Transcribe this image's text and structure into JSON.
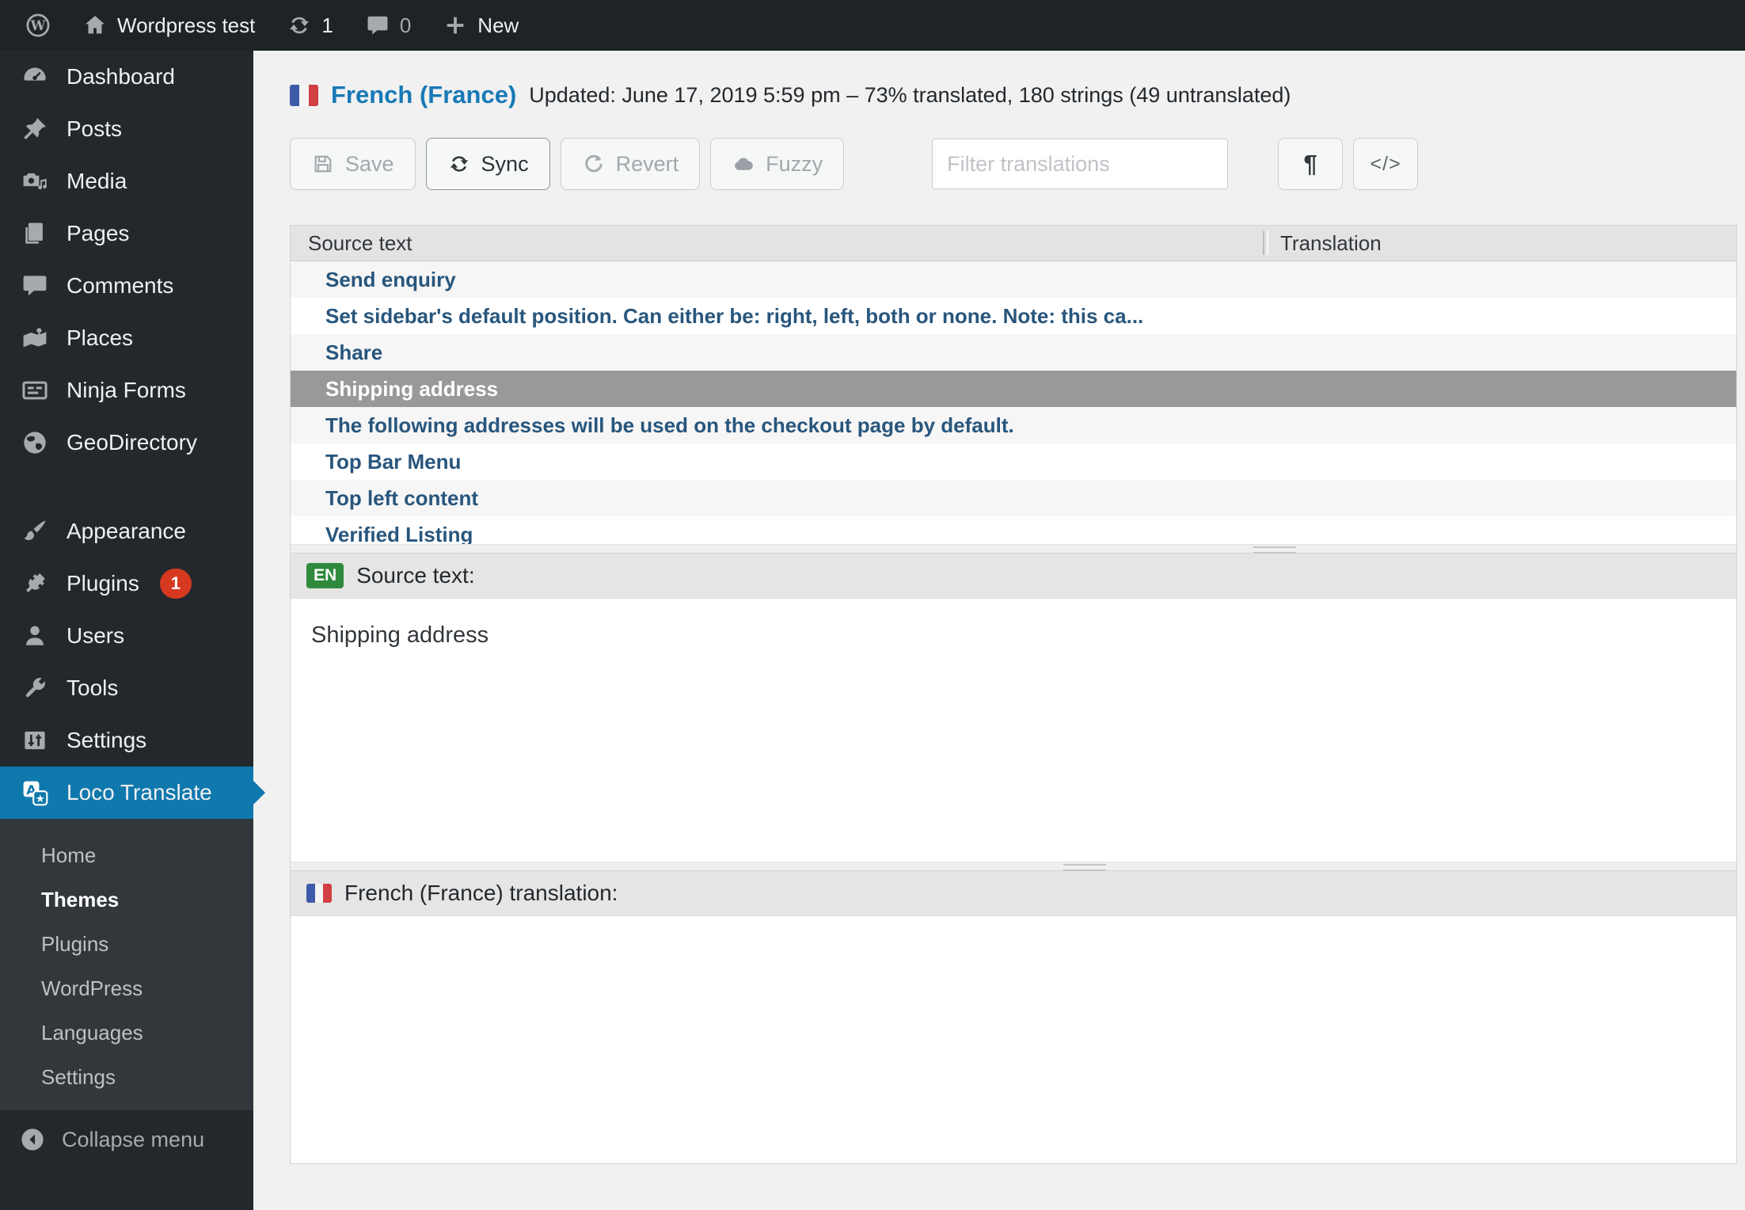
{
  "admin_bar": {
    "site_name": "Wordpress test",
    "update_count": "1",
    "comment_count": "0",
    "new_label": "New"
  },
  "sidebar": {
    "items": [
      {
        "label": "Dashboard"
      },
      {
        "label": "Posts"
      },
      {
        "label": "Media"
      },
      {
        "label": "Pages"
      },
      {
        "label": "Comments"
      },
      {
        "label": "Places"
      },
      {
        "label": "Ninja Forms"
      },
      {
        "label": "GeoDirectory"
      },
      {
        "label": "Appearance"
      },
      {
        "label": "Plugins",
        "badge": "1"
      },
      {
        "label": "Users"
      },
      {
        "label": "Tools"
      },
      {
        "label": "Settings"
      },
      {
        "label": "Loco Translate"
      }
    ],
    "submenu": [
      {
        "label": "Home"
      },
      {
        "label": "Themes"
      },
      {
        "label": "Plugins"
      },
      {
        "label": "WordPress"
      },
      {
        "label": "Languages"
      },
      {
        "label": "Settings"
      }
    ],
    "collapse_label": "Collapse menu"
  },
  "header": {
    "title": "French (France)",
    "updated": "Updated: June 17, 2019 5:59 pm – 73% translated, 180 strings (49 untranslated)"
  },
  "toolbar": {
    "save": "Save",
    "sync": "Sync",
    "revert": "Revert",
    "fuzzy": "Fuzzy",
    "filter_placeholder": "Filter translations",
    "pilcrow": "¶",
    "code": "</>"
  },
  "table": {
    "columns": [
      "Source text",
      "Translation"
    ],
    "rows": [
      "Send enquiry",
      "Set sidebar's default position. Can either be: right, left, both or none. Note: this ca...",
      "Share",
      "Shipping address",
      "The following addresses will be used on the checkout page by default.",
      "Top Bar Menu",
      "Top left content",
      "Verified Listing"
    ],
    "selected": "Shipping address"
  },
  "source_panel": {
    "lang_badge": "EN",
    "label": "Source text:",
    "content": "Shipping address"
  },
  "translation_panel": {
    "label": "French (France) translation:",
    "content": ""
  },
  "colors": {
    "admin_bar_bg": "#1d2327",
    "sidebar_bg": "#23282d",
    "submenu_bg": "#32373c",
    "current_item_blue": "#0f78ad",
    "plugins_badge_red": "#d63920",
    "link_blue": "#1879b6",
    "row_link_blue": "#28567d",
    "selected_row_gray": "#999999",
    "en_badge_green": "#2f8a3d",
    "page_bg": "#f1f1f1"
  }
}
